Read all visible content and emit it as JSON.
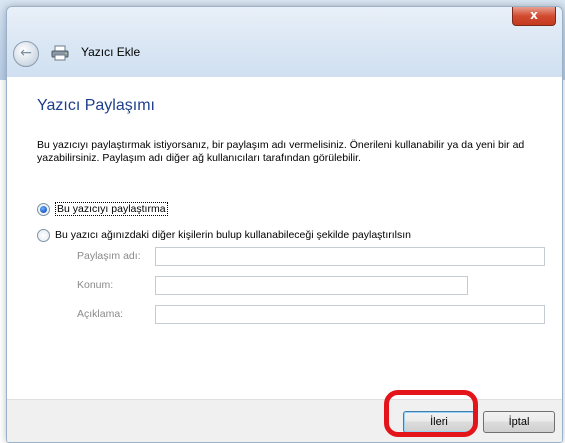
{
  "window": {
    "title": "Yazıcı Ekle",
    "close_glyph": "x"
  },
  "page": {
    "heading": "Yazıcı Paylaşımı",
    "description": "Bu yazıcıyı paylaştırmak istiyorsanız, bir paylaşım adı vermelisiniz. Önerileni kullanabilir ya da yeni bir ad yazabilirsiniz. Paylaşım adı diğer ağ kullanıcıları tarafından görülebilir."
  },
  "options": [
    {
      "label": "Bu yazıcıyı paylaştırma",
      "selected": true
    },
    {
      "label": "Bu yazıcı ağınızdaki diğer kişilerin bulup kullanabileceği şekilde paylaştırılsın",
      "selected": false
    }
  ],
  "fields": {
    "share_name": {
      "label": "Paylaşım adı:",
      "value": ""
    },
    "location": {
      "label": "Konum:",
      "value": ""
    },
    "comment": {
      "label": "Açıklama:",
      "value": ""
    }
  },
  "buttons": {
    "next": "İleri",
    "cancel": "İptal"
  },
  "colors": {
    "heading": "#1e3f8c",
    "highlight": "#e3141a"
  },
  "icons": {
    "back": "back-arrow-icon",
    "printer": "printer-icon",
    "close": "close-icon"
  }
}
